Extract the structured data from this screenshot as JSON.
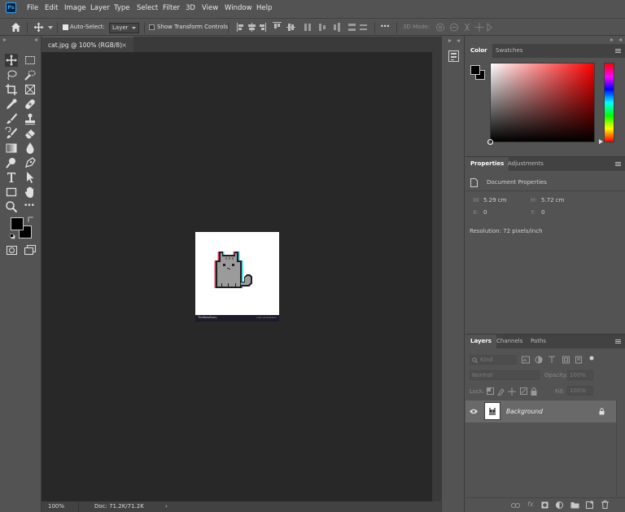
{
  "app": {
    "logo": "Ps"
  },
  "menu": [
    "File",
    "Edit",
    "Image",
    "Layer",
    "Type",
    "Select",
    "Filter",
    "3D",
    "View",
    "Window",
    "Help"
  ],
  "options": {
    "auto_select_label": "Auto-Select:",
    "auto_select_checked": true,
    "auto_select_target": "Layer",
    "show_transform_label": "Show Transform Controls",
    "show_transform_checked": false,
    "mode_3d_label": "3D Mode:",
    "more_label": "•••"
  },
  "document": {
    "tab_title": "cat.jpg @ 100% (RGB/8)",
    "tab_close": "×",
    "zoom": "100%",
    "doc_size": "Doc: 71.2K/71.2K",
    "status_arrow": "›",
    "image_footer_left": "TheNewStory",
    "image_footer_right": "pixel cat illustration"
  },
  "tools": {
    "more_tools": "•••",
    "foreground_color": "#000000",
    "background_color": "#000000"
  },
  "color_panel": {
    "tabs": [
      "Color",
      "Swatches"
    ],
    "active_tab": "Color",
    "hue_base": "#ff0000"
  },
  "properties_panel": {
    "tabs": [
      "Properties",
      "Adjustments"
    ],
    "active_tab": "Properties",
    "doc_props_label": "Document Properties",
    "w_label": "W:",
    "w_value": "5.29 cm",
    "h_label": "H:",
    "h_value": "5.72 cm",
    "x_label": "X:",
    "x_value": "0",
    "y_label": "Y:",
    "y_value": "0",
    "resolution": "Resolution: 72 pixels/inch"
  },
  "layers_panel": {
    "tabs": [
      "Layers",
      "Channels",
      "Paths"
    ],
    "active_tab": "Layers",
    "filter_label": "Kind",
    "blend_mode": "Normal",
    "opacity_label": "Opacity:",
    "opacity_value": "100%",
    "lock_label": "Lock:",
    "fill_label": "Fill:",
    "fill_value": "100%",
    "layers": [
      {
        "name": "Background",
        "visible": true,
        "locked": true
      }
    ],
    "footer_fx": "fx"
  }
}
